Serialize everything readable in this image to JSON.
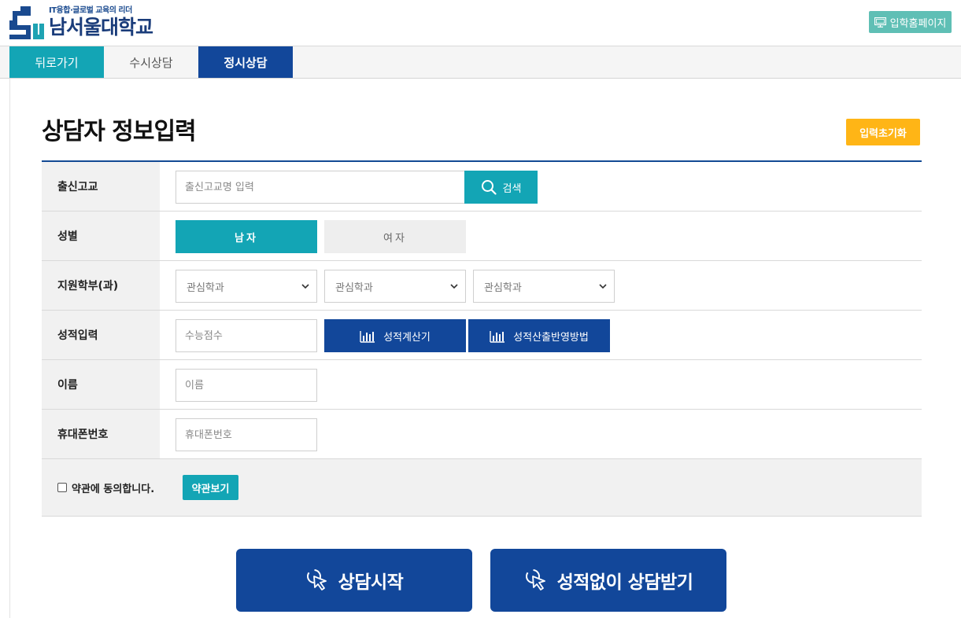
{
  "header": {
    "slogan": "IT융합·글로벌 교육의 리더",
    "university_name": "남서울대학교",
    "admission_home_label": "입학홈페이지"
  },
  "tabs": {
    "back": "뒤로가기",
    "susi": "수시상담",
    "jeongsi": "정시상담"
  },
  "page": {
    "title": "상담자 정보입력",
    "reset_label": "입력초기화"
  },
  "form": {
    "school": {
      "label": "출신고교",
      "placeholder": "출신고교명 입력",
      "search_label": "검색"
    },
    "gender": {
      "label": "성별",
      "male": "남자",
      "female": "여자",
      "selected": "male"
    },
    "department": {
      "label": "지원학부(과)",
      "options": [
        "관심학과",
        "관심학과",
        "관심학과"
      ]
    },
    "grade": {
      "label": "성적입력",
      "placeholder": "수능점수",
      "calc_label": "성적계산기",
      "method_label": "성적산출반영방법"
    },
    "name": {
      "label": "이름",
      "placeholder": "이름"
    },
    "phone": {
      "label": "휴대폰번호",
      "placeholder": "휴대폰번호"
    },
    "agree": {
      "label": "약관에 동의합니다.",
      "terms_label": "약관보기",
      "checked": false
    }
  },
  "actions": {
    "start_label": "상담시작",
    "no_grade_label": "성적없이 상담받기"
  },
  "colors": {
    "navy": "#12479a",
    "teal": "#13a5b5",
    "orange": "#ffb516",
    "mint": "#5fbfb5"
  }
}
